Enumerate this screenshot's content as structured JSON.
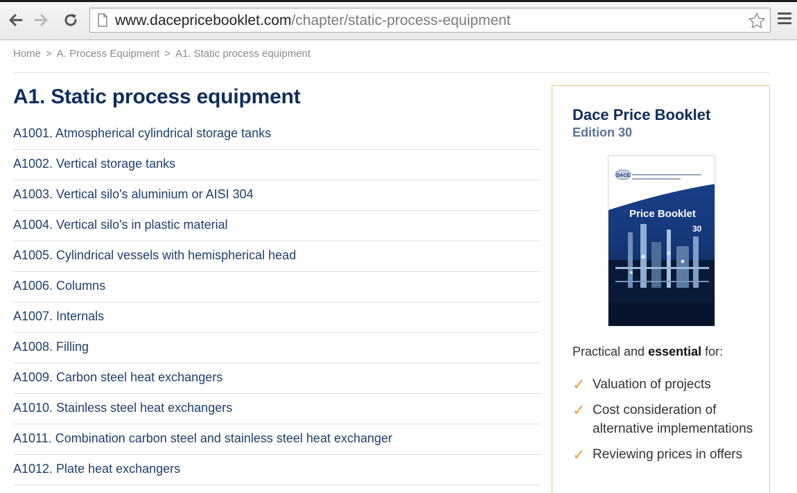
{
  "browser": {
    "url_host": "www.dacepricebooklet.com",
    "url_path": "/chapter/static-process-equipment",
    "icons": [
      "back-icon",
      "forward-icon",
      "reload-icon",
      "page-icon",
      "star-icon",
      "menu-icon"
    ]
  },
  "breadcrumb": {
    "items": [
      "Home",
      "A. Process Equipment",
      "A1. Static process equipment"
    ],
    "separator": ">"
  },
  "main": {
    "title": "A1. Static process equipment",
    "items": [
      "A1001. Atmospherical cylindrical storage tanks",
      "A1002. Vertical storage tanks",
      "A1003. Vertical silo's aluminium or AISI 304",
      "A1004. Vertical silo's in plastic material",
      "A1005. Cylindrical vessels with hemispherical head",
      "A1006. Columns",
      "A1007. Internals",
      "A1008. Filling",
      "A1009. Carbon steel heat exchangers",
      "A1010. Stainless steel heat exchangers",
      "A1011. Combination carbon steel and stainless steel heat exchanger",
      "A1012. Plate heat exchangers"
    ]
  },
  "sidebar": {
    "title": "Dace Price Booklet",
    "edition": "Edition 30",
    "cover": {
      "logo": "DACE",
      "title": "Price Booklet",
      "number": "30"
    },
    "intro_pre": "Practical and ",
    "intro_bold": "essential",
    "intro_post": " for:",
    "benefits": [
      "Valuation of projects",
      "Cost consideration of alternative implementations",
      "Reviewing prices in offers"
    ],
    "check_glyph": "✓"
  },
  "colors": {
    "title_navy": "#0e2d5b",
    "link_blue": "#1e3f6e",
    "edition_blue": "#5a7399",
    "promo_border": "#f1c27a",
    "check_orange": "#f0a030"
  }
}
